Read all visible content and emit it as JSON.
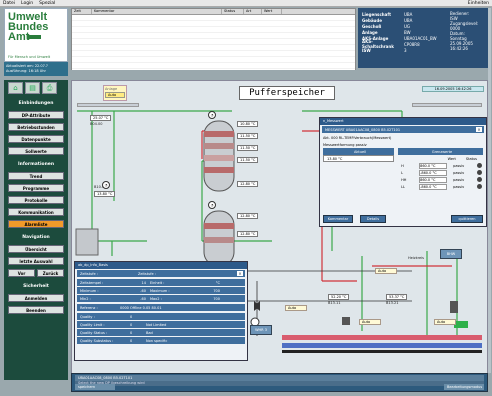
{
  "menubar": {
    "items": [
      "Datei",
      "Login",
      "Spezial"
    ],
    "right": "Einheiten"
  },
  "logo": {
    "line1": "Umwelt",
    "line2": "Bundes",
    "line3": "Amt",
    "tagline": "Für Mensch und Umwelt"
  },
  "dates": {
    "line1": "Aktualisiert am: 22.07.?",
    "line2": "Ausführung: 16:18 Uhr"
  },
  "topgrid": {
    "headers": [
      "Zeit",
      "Kommentar",
      "Status",
      "Art",
      "Wert"
    ]
  },
  "info": {
    "rows": [
      {
        "k": "Liegenschaft",
        "v": "UBA"
      },
      {
        "k": "Gebäude",
        "v": "UBA"
      },
      {
        "k": "Geschoß",
        "v": "UG"
      },
      {
        "k": "Anlage",
        "v": "BW"
      },
      {
        "k": "AKS-Anlage",
        "v": "UBA01AC01_BW"
      },
      {
        "k": "AKS-Schaltschrank",
        "v": "CP08R8"
      },
      {
        "k": "ISW",
        "v": "3"
      }
    ],
    "right": [
      "Bediener:",
      "ISW",
      "Zugangslevel:",
      "0000",
      "Datum:",
      "Sonntag",
      "25.09.2005",
      "16:42:26"
    ]
  },
  "sidebar": {
    "icons": [
      "home-icon",
      "folder-icon",
      "print-icon"
    ],
    "sections": [
      {
        "type": "head",
        "label": "Einbindungen"
      },
      {
        "type": "btn",
        "label": "DP-Attribute"
      },
      {
        "type": "btn",
        "label": "Betriebsstunden"
      },
      {
        "type": "btn",
        "label": "Datenpunkte"
      },
      {
        "type": "btn",
        "label": "Sollwerte"
      },
      {
        "type": "head",
        "label": "Informationen"
      },
      {
        "type": "btn",
        "label": "Trend"
      },
      {
        "type": "btn",
        "label": "Programme"
      },
      {
        "type": "btn",
        "label": "Protokolle"
      },
      {
        "type": "btn",
        "label": "Kommunikation"
      },
      {
        "type": "btn",
        "label": "Alarmliste",
        "highlight": true
      },
      {
        "type": "head",
        "label": "Navigation"
      },
      {
        "type": "btn",
        "label": "Übersicht"
      },
      {
        "type": "btn",
        "label": "letzte Auswahl"
      },
      {
        "type": "pair",
        "labels": [
          "Vor",
          "Zurück"
        ]
      },
      {
        "type": "head",
        "label": "Sicherheit"
      },
      {
        "type": "btn",
        "label": "Anmelden"
      },
      {
        "type": "btn",
        "label": "Beenden"
      }
    ]
  },
  "main": {
    "title": "Pufferspeicher",
    "topbox": {
      "title": "Anlage",
      "value": "Auto"
    },
    "dateright": "16.09.2005 16:42:26",
    "sensor1": "25.07 °C",
    "sensor1b": "B04.00",
    "sensor2": "13.80 °C",
    "sensor2b": "B10.02",
    "tank_values": [
      "10.80 °C",
      "11.50 °C",
      "11.50 °C",
      "11.50 °C",
      "12.80 °C",
      "12.80 °C",
      "12.80 °C"
    ],
    "right_vals": [
      "52.20 °C",
      "53.37 °C"
    ],
    "right_labels": [
      "B13.11",
      "B13.21"
    ],
    "auto_labels": [
      "Auto",
      "Auto",
      "Auto",
      "Auto"
    ],
    "whr": "WHR 3",
    "hv": "Heizkreis",
    "btn_right": "BHW"
  },
  "dialog1": {
    "title": "n_Messwert",
    "rows": [
      "MESSWERT     UBA01AAC08_0800 B5.02T101",
      "Akt. 000 RL-TEMP.Verbrauch(Messwert)",
      "Messwertformung     passiv"
    ],
    "head": [
      "Aktuell",
      "Grenzwerte"
    ],
    "current": "13.80 °C",
    "limit_header": [
      "Wert",
      "Status"
    ],
    "limits": [
      {
        "k": "H",
        "v": "860.0 °C",
        "s": "passiv"
      },
      {
        "k": "L",
        "v": "-860.0 °C",
        "s": "passiv"
      },
      {
        "k": "HH",
        "v": "860.0 °C",
        "s": "passiv"
      },
      {
        "k": "LL",
        "v": "-860.0 °C",
        "s": "passiv"
      }
    ],
    "buttons": [
      "Kommentar",
      "Details",
      "quittieren"
    ]
  },
  "dialog2": {
    "title": "ab_dp_Info_Basis",
    "head": [
      "Zeitstufe :",
      "Zeitstufe :"
    ],
    "rows": [
      {
        "k": "Zeitstempel :",
        "v": "14",
        "k2": "Einheit :",
        "v2": "°C"
      },
      {
        "k": "Minimum :",
        "v": "-60",
        "k2": "Maximum :",
        "v2": "700"
      },
      {
        "k": "Min2 :",
        "v": "-60",
        "k2": "Max2 :",
        "v2": "700"
      }
    ],
    "ref": {
      "k": "Referenz :",
      "v": "0000 Offline 0.05 80.01"
    },
    "quality": [
      {
        "k": "Quality :",
        "v": "0"
      },
      {
        "k": "Quality Limit :",
        "v": "0",
        "t": "Not Limited"
      },
      {
        "k": "Quality Status :",
        "v": "0",
        "t": "Bad"
      },
      {
        "k": "Quality Substatus :",
        "v": "0",
        "t": "Non specific"
      }
    ]
  },
  "status": {
    "r1": "UBA01AAC08_0800 B5.02T101",
    "r2": "Select the new DP (beschreibung wird",
    "b1": "speichern",
    "b2": "Bearbeitungsmodus"
  }
}
